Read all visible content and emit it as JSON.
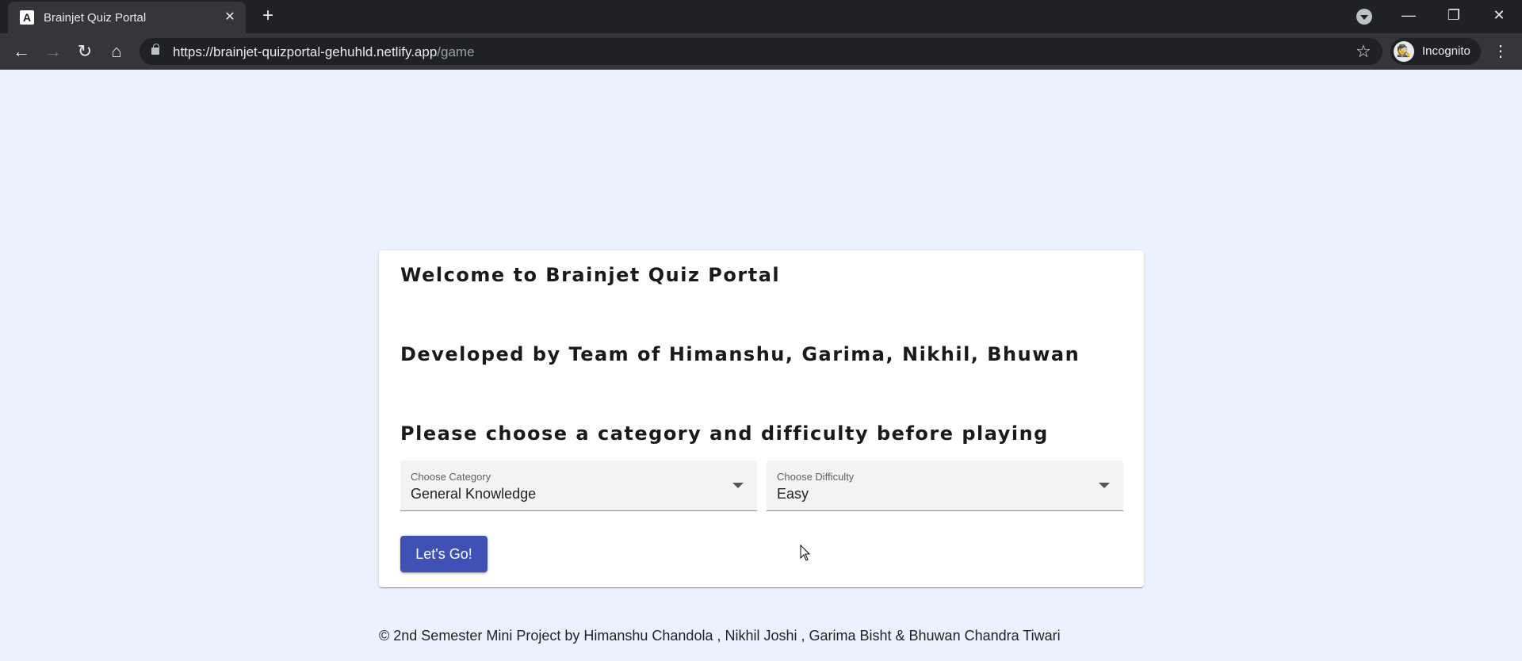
{
  "browser": {
    "tab_title": "Brainjet Quiz Portal",
    "favicon_letter": "A",
    "url_host": "https://brainjet-quizportal-gehuhld.netlify.app",
    "url_path": "/game",
    "profile_label": "Incognito",
    "icons": {
      "tab_close": "✕",
      "new_tab": "+",
      "back": "←",
      "forward": "→",
      "reload": "↻",
      "home": "⌂",
      "star": "☆",
      "menu": "⋮",
      "minimize": "—",
      "restore": "❐",
      "close": "✕",
      "incognito": "🕵"
    }
  },
  "card": {
    "welcome": "Welcome to Brainjet Quiz Portal",
    "developers": "Developed by Team of Himanshu, Garima, Nikhil, Bhuwan",
    "instruction": "Please choose a category and difficulty before playing",
    "category": {
      "label": "Choose Category",
      "value": "General Knowledge"
    },
    "difficulty": {
      "label": "Choose Difficulty",
      "value": "Easy"
    },
    "go_button": "Let's Go!"
  },
  "footer": "© 2nd Semester Mini Project by Himanshu Chandola , Nikhil Joshi , Garima Bisht & Bhuwan Chandra Tiwari",
  "colors": {
    "page_background": "#eaf2fd",
    "primary_button": "#3f51b5",
    "chrome_dark": "#202124"
  }
}
